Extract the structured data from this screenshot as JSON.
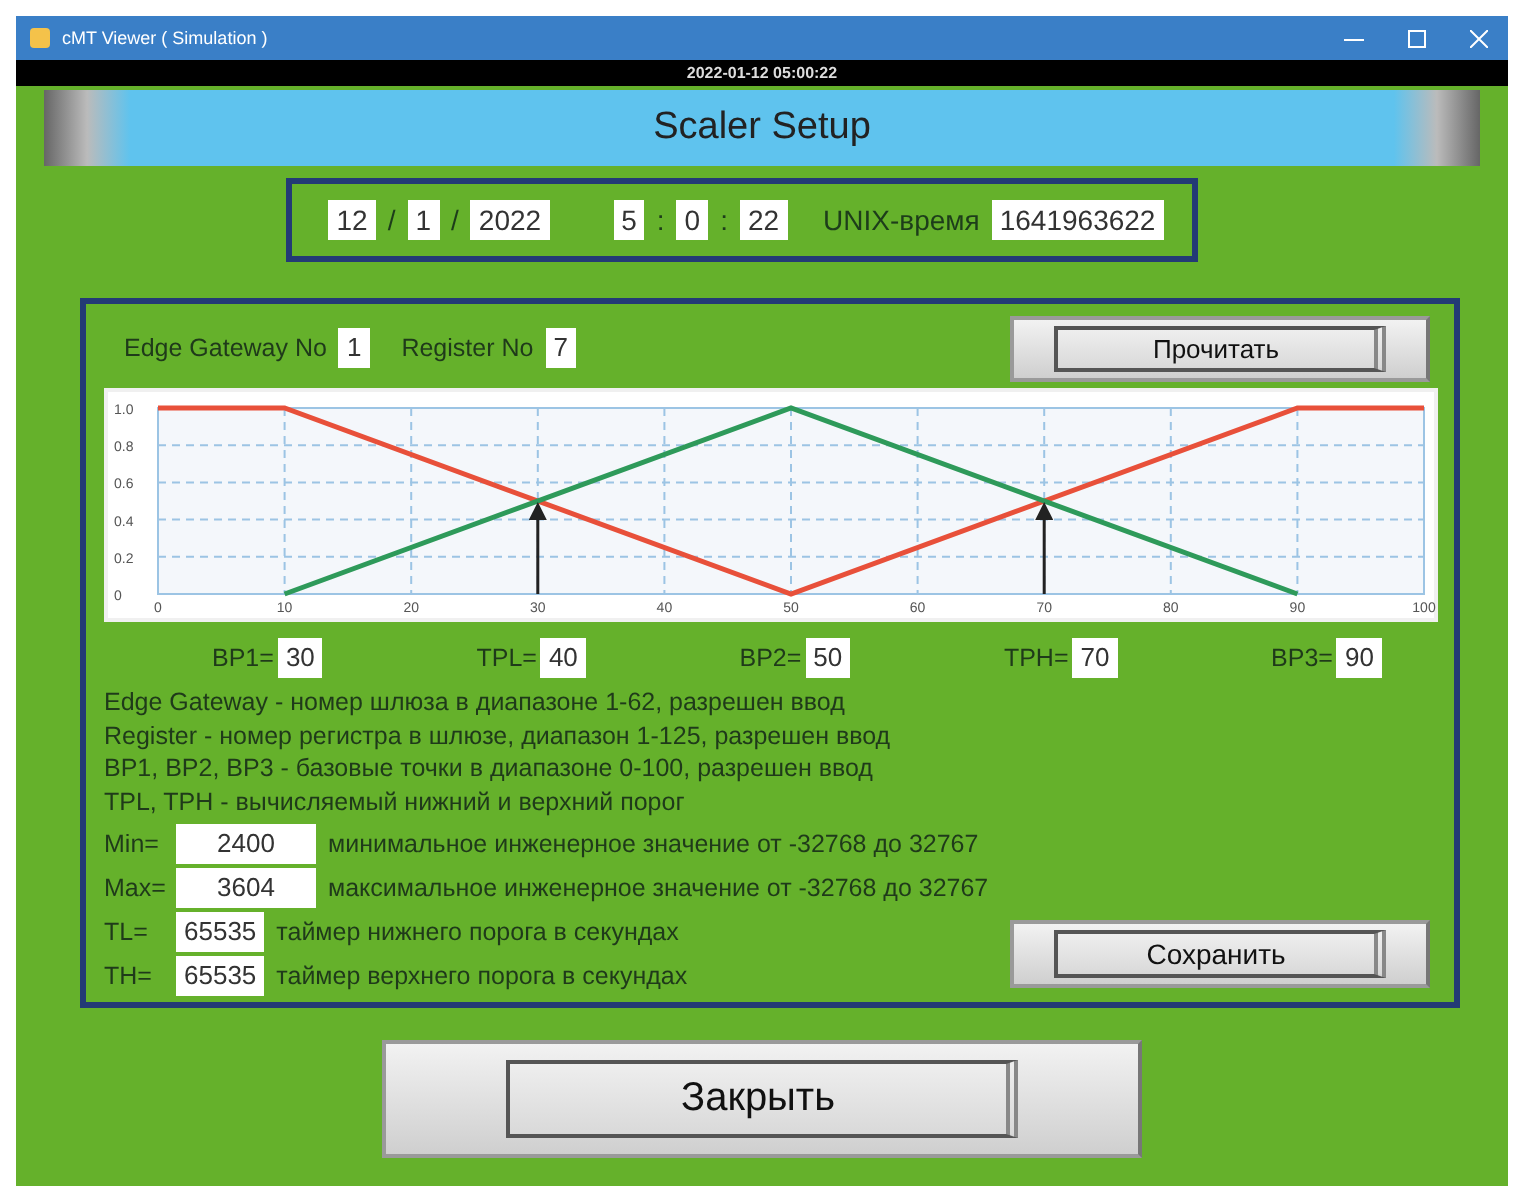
{
  "window": {
    "title": "cMT Viewer ( Simulation )"
  },
  "clock": "2022-01-12 05:00:22",
  "header": {
    "title": "Scaler Setup"
  },
  "date_time": {
    "parts": [
      {
        "kind": "field",
        "text": "12"
      },
      {
        "kind": "sep",
        "text": "/"
      },
      {
        "kind": "field",
        "text": "1"
      },
      {
        "kind": "sep",
        "text": "/"
      },
      {
        "kind": "field",
        "text": "2022"
      },
      {
        "kind": "gap"
      },
      {
        "kind": "field",
        "text": "5"
      },
      {
        "kind": "sep",
        "text": ":"
      },
      {
        "kind": "field",
        "text": "0"
      },
      {
        "kind": "sep",
        "text": ":"
      },
      {
        "kind": "field",
        "text": "22"
      }
    ],
    "unix_label": "UNIX-время",
    "unix_value": "1641963622"
  },
  "panel": {
    "gateway": {
      "label": "Edge Gateway No",
      "value": "1"
    },
    "register": {
      "label": "Register No",
      "value": "7"
    },
    "read_button": "Прочитать",
    "chart_data": {
      "type": "line",
      "x": [
        0,
        10,
        50,
        90,
        100
      ],
      "series": [
        {
          "color": "#e8503a",
          "values": [
            1,
            1,
            0,
            1,
            1
          ]
        },
        {
          "color": "#2e9a5a",
          "values": [
            null,
            0,
            1,
            0,
            null
          ]
        }
      ],
      "grid": true,
      "xlim": [
        0,
        100
      ],
      "ylim": [
        0,
        1
      ],
      "xticks": [
        0,
        10,
        20,
        30,
        40,
        50,
        60,
        70,
        80,
        90,
        100
      ],
      "yticks": [
        {
          "value": 0,
          "label": "0"
        },
        {
          "value": 0.2,
          "label": "0.2"
        },
        {
          "value": 0.4,
          "label": "0.4"
        },
        {
          "value": 0.6,
          "label": "0.6"
        },
        {
          "value": 0.8,
          "label": "0.8"
        },
        {
          "value": 1,
          "label": "1.0"
        }
      ]
    },
    "points": [
      {
        "label": "BP1=",
        "value": "30"
      },
      {
        "label": "TPL=",
        "value": "40"
      },
      {
        "label": "BP2=",
        "value": "50"
      },
      {
        "label": "TPH=",
        "value": "70"
      },
      {
        "label": "BP3=",
        "value": "90"
      }
    ],
    "notes": [
      "Edge Gateway - номер шлюза в диапазоне 1-62, разрешен ввод",
      "Register - номер регистра в шлюзе, диапазон 1-125, разрешен ввод",
      "BP1, BP2, BP3 - базовые точки в диапазоне 0-100, разрешен ввод",
      "TPL, TPH - вычисляемый нижний и верхний порог"
    ],
    "params": [
      {
        "label": "Min=",
        "value": "2400",
        "description": "минимальное инженерное значение от  -32768 до 32767"
      },
      {
        "label": "Max=",
        "value": "3604",
        "description": "максимальное инженерное значение от  -32768 до 32767"
      },
      {
        "label": "TL=",
        "value": "65535",
        "description": "таймер нижнего порога в секундах"
      },
      {
        "label": "TH=",
        "value": "65535",
        "description": "таймер верхнего порога в секундах"
      }
    ],
    "save_button": "Сохранить"
  },
  "close_button": "Закрыть"
}
